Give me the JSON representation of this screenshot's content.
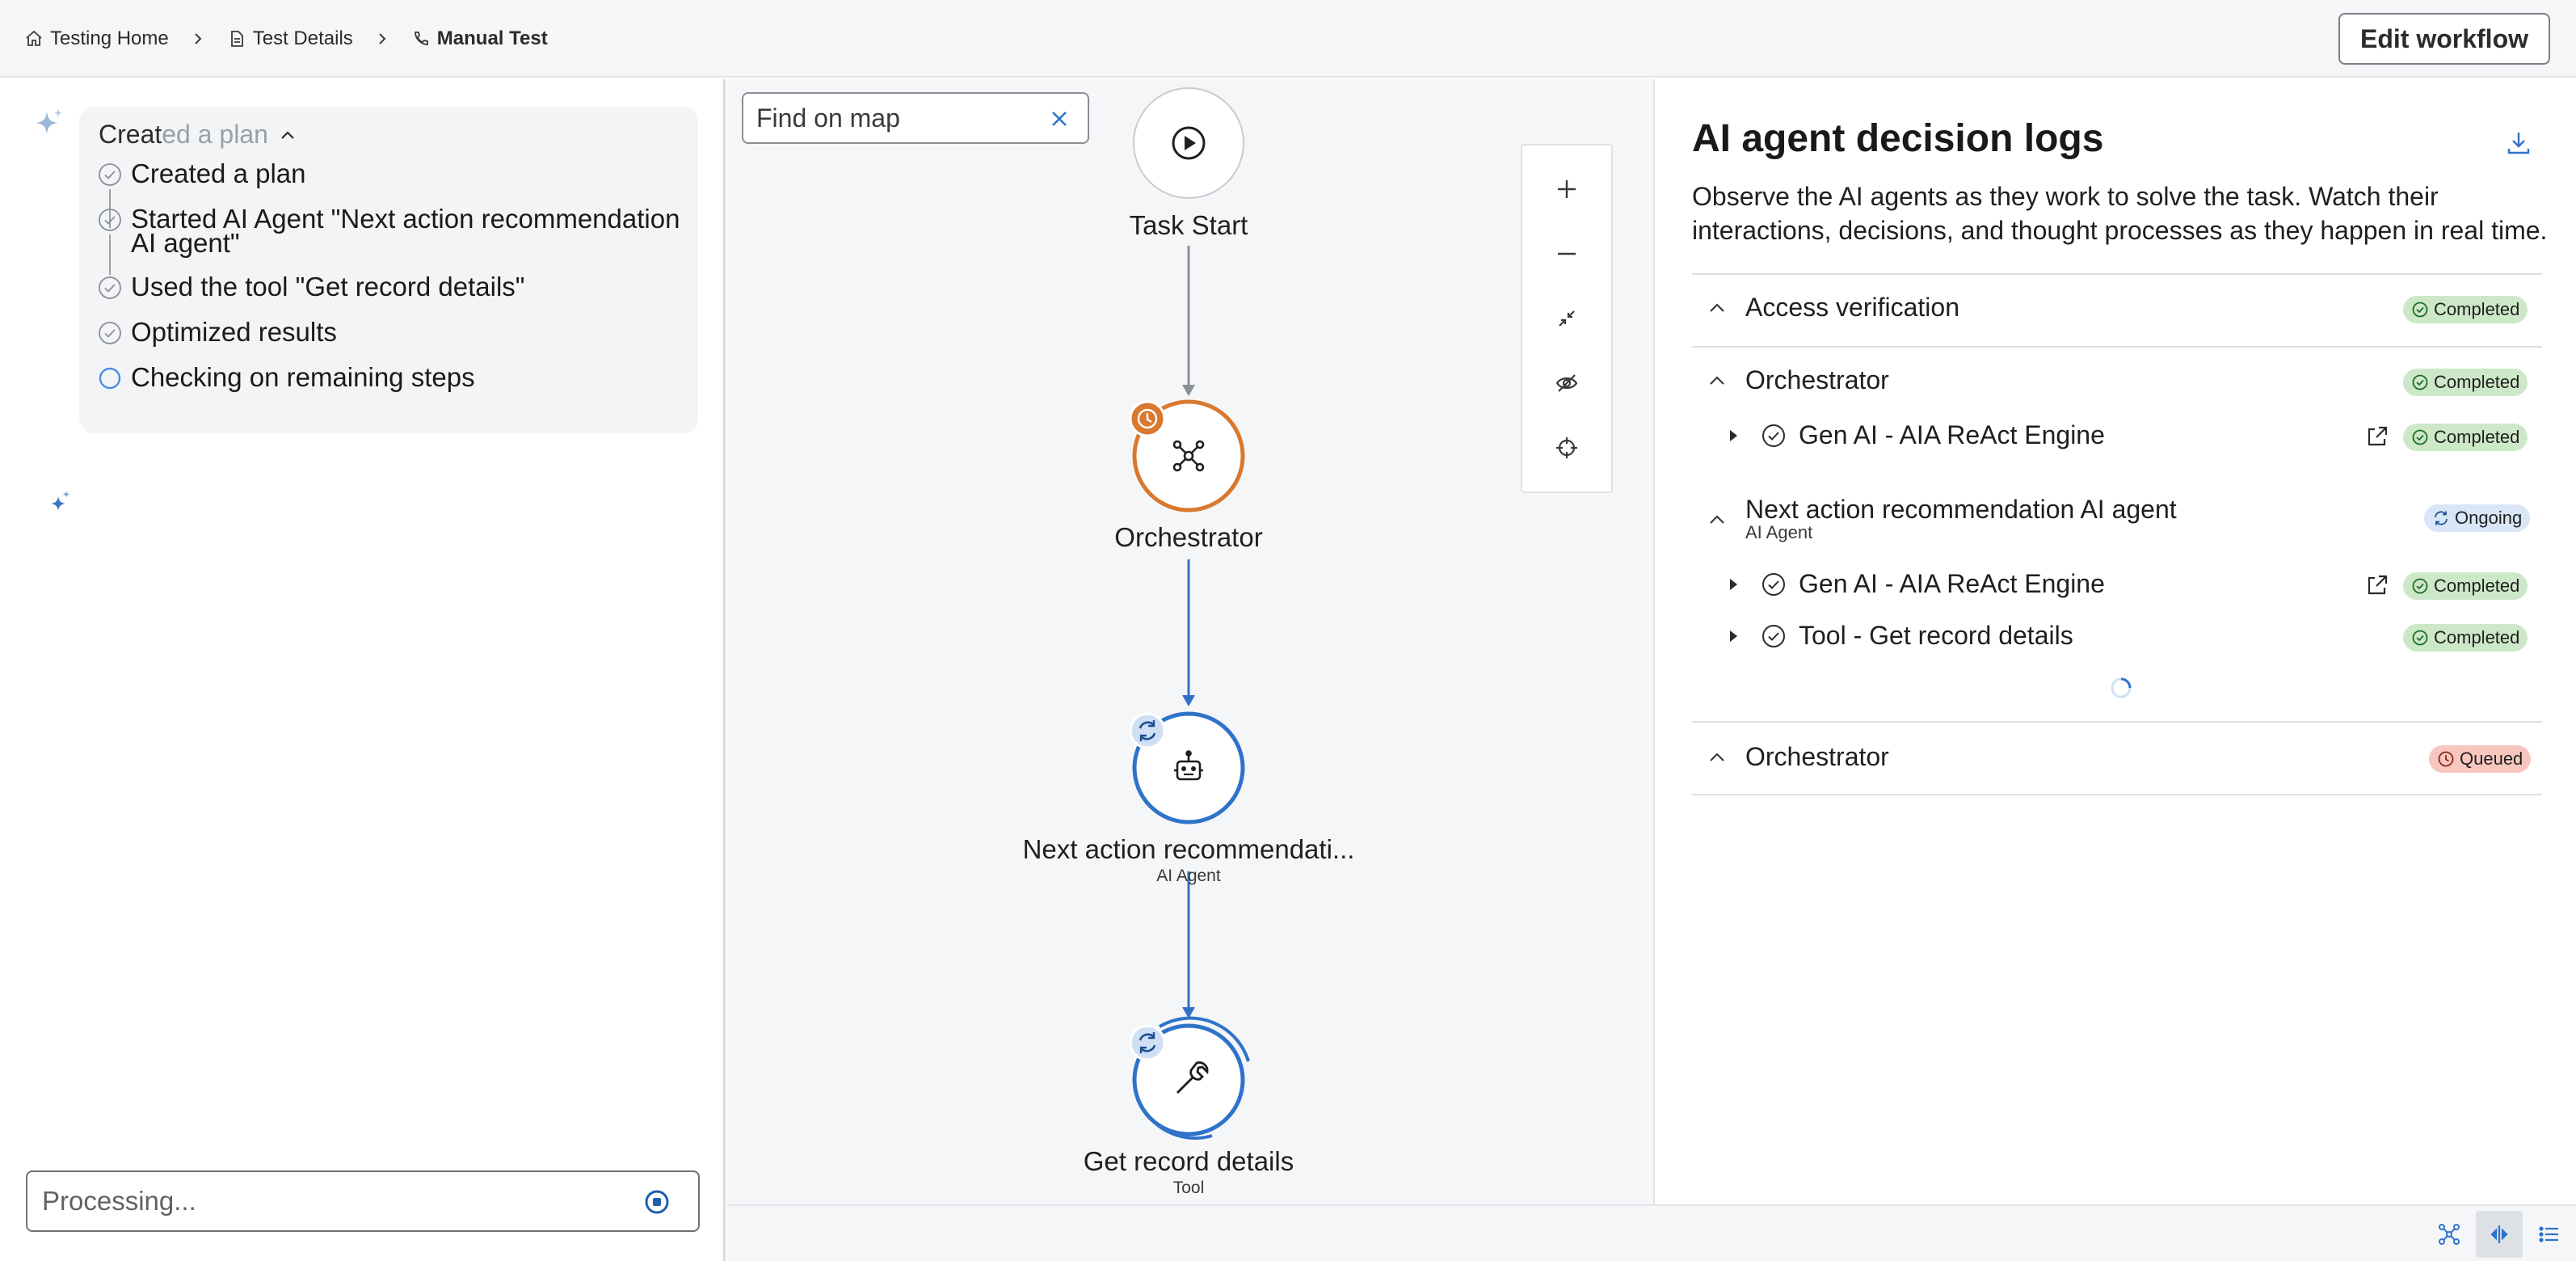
{
  "breadcrumb": {
    "items": [
      {
        "label": "Testing Home",
        "icon": "home-icon"
      },
      {
        "label": "Test Details",
        "icon": "document-icon"
      },
      {
        "label": "Manual Test",
        "icon": "phone-icon"
      }
    ]
  },
  "toolbar": {
    "edit_workflow_label": "Edit workflow"
  },
  "plan": {
    "header_word1": "Creat",
    "header_word2": "ed a plan",
    "steps": [
      {
        "label": "Created a plan",
        "status": "done"
      },
      {
        "label": "Started AI Agent \"Next action recommendation AI agent\"",
        "status": "done"
      },
      {
        "label": "Used the tool \"Get record details\"",
        "status": "done"
      },
      {
        "label": "Optimized results",
        "status": "done"
      },
      {
        "label": "Checking on remaining steps",
        "status": "in-progress"
      }
    ]
  },
  "input": {
    "placeholder": "Processing..."
  },
  "map": {
    "search_placeholder": "Find on map",
    "nodes": [
      {
        "label": "Task Start",
        "sub": ""
      },
      {
        "label": "Orchestrator",
        "sub": ""
      },
      {
        "label": "Next action recommendati...",
        "sub": "AI Agent"
      },
      {
        "label": "Get record details",
        "sub": "Tool"
      }
    ]
  },
  "logs": {
    "title": "AI agent decision logs",
    "description": "Observe the AI agents as they work to solve the task. Watch their interactions, decisions, and thought processes as they happen in real time.",
    "sections": [
      {
        "title": "Access verification",
        "sub": "",
        "status": "Completed"
      },
      {
        "title": "Orchestrator",
        "sub": "",
        "status": "Completed",
        "rows": [
          {
            "label": "Gen AI - AIA ReAct Engine",
            "status": "Completed"
          }
        ]
      },
      {
        "title": "Next action recommendation AI agent",
        "sub": "AI Agent",
        "status": "Ongoing",
        "rows": [
          {
            "label": "Gen AI - AIA ReAct Engine",
            "status": "Completed"
          },
          {
            "label": "Tool - Get record details",
            "status": "Completed"
          }
        ]
      },
      {
        "title": "Orchestrator",
        "sub": "",
        "status": "Queued"
      }
    ]
  },
  "colors": {
    "accent_blue": "#2f73c9",
    "orange": "#d9782f",
    "completed_bg": "#cde8c8",
    "ongoing_bg": "#d8e6f8",
    "queued_bg": "#f7c7bf"
  }
}
